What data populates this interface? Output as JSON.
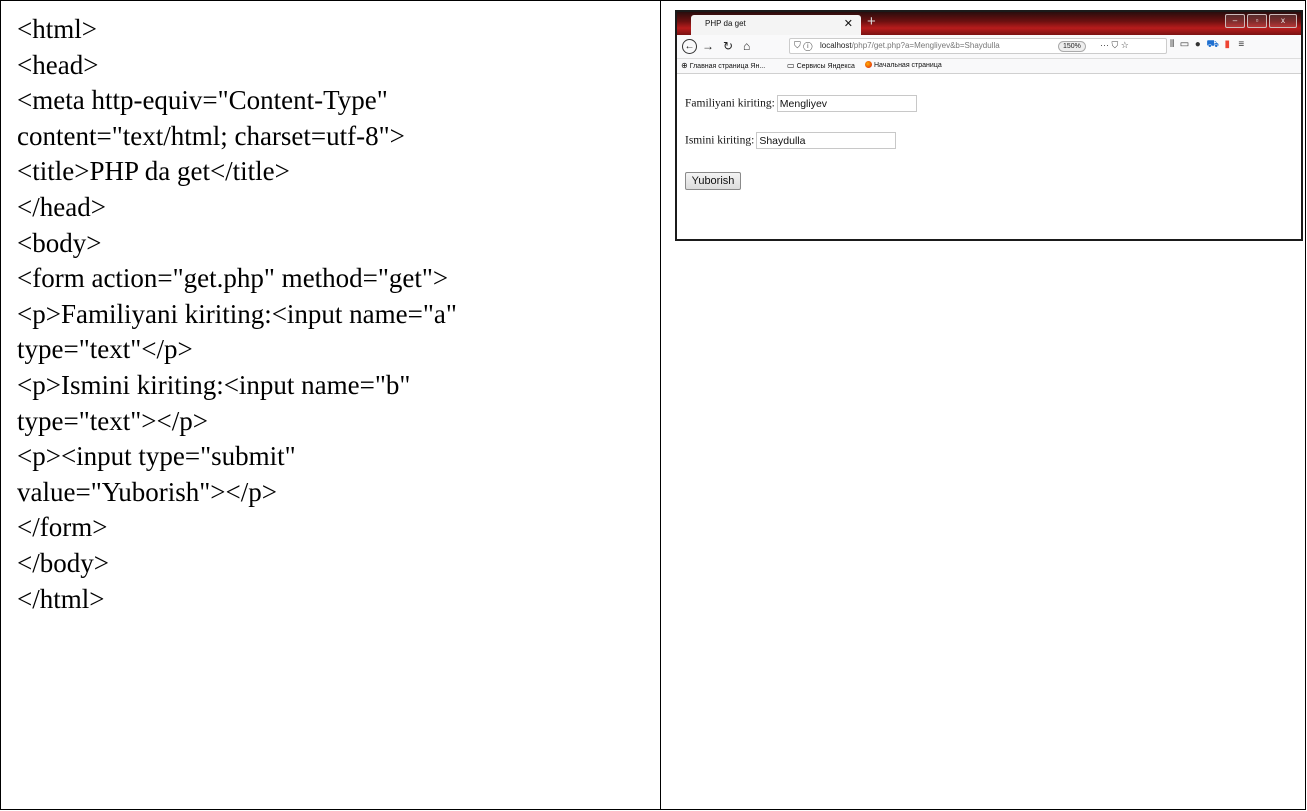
{
  "code_lines": [
    "<html>",
    "<head>",
    "<meta http-equiv=\"Content-Type\"",
    "content=\"text/html; charset=utf-8\">",
    "<title>PHP da get</title>",
    "</head>",
    "<body>",
    "<form action=\"get.php\" method=\"get\">",
    "<p>Familiyani kiriting:<input name=\"a\"",
    "type=\"text\"</p>",
    "<p>Ismini kiriting:<input name=\"b\"",
    "type=\"text\"></p>",
    "<p><input type=\"submit\"",
    "value=\"Yuborish\"></p>",
    "</form>",
    "</body>",
    "</html>"
  ],
  "browser": {
    "tab_title": "PHP da get",
    "url_host": "localhost",
    "url_path": "/php7/get.php?a=Mengliyev&b=Shaydulla",
    "zoom": "150%",
    "bookmarks": [
      "Главная страница Ян...",
      "Сервисы Яндекса",
      "Начальная страница"
    ],
    "form": {
      "familiya_label": "Familiyani kiriting:",
      "familiya_value": "Mengliyev",
      "ism_label": "Ismini kiriting:",
      "ism_value": "Shaydulla",
      "submit_label": "Yuborish"
    }
  }
}
